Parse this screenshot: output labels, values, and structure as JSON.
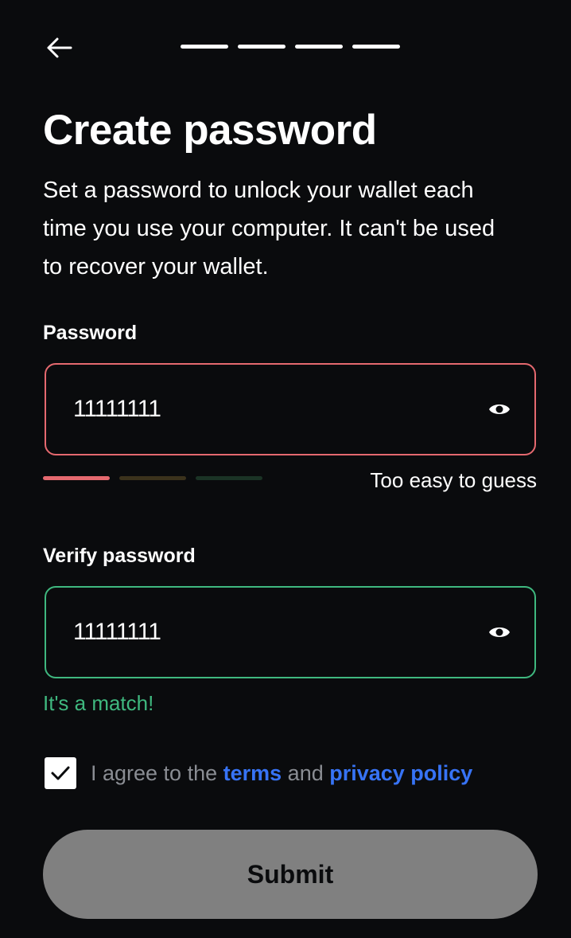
{
  "header": {
    "back_icon": "arrow-left-icon",
    "progress_steps": 4
  },
  "title": "Create password",
  "subtitle": "Set a password to unlock your wallet each time you use your computer. It can't be used to recover your wallet.",
  "password": {
    "label": "Password",
    "value": "11111111",
    "toggle_icon": "eye-icon",
    "strength_hint": "Too easy to guess",
    "strength_level": 1,
    "strength_colors": [
      "#e5696f",
      "#3b321c",
      "#1b3325"
    ]
  },
  "verify": {
    "label": "Verify password",
    "value": "11111111",
    "toggle_icon": "eye-icon",
    "status": "It's a match!"
  },
  "agree": {
    "checked": true,
    "prefix": "I agree to the ",
    "terms_link": "terms",
    "middle": " and ",
    "privacy_link": "privacy policy"
  },
  "submit_label": "Submit",
  "colors": {
    "background": "#0a0b0d",
    "error": "#e5696f",
    "success": "#3fb87f",
    "link": "#3773f5",
    "button_disabled": "#808080"
  }
}
